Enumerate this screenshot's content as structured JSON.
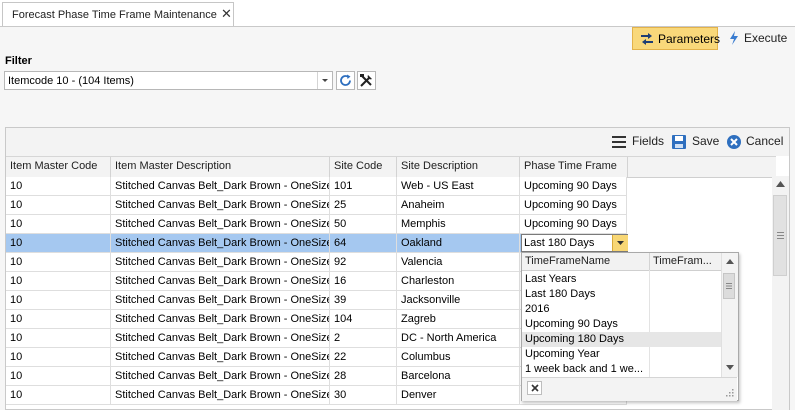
{
  "tab": {
    "title": "Forecast Phase Time Frame Maintenance",
    "close_glyph": "✕"
  },
  "toolbar": {
    "parameters_label": "Parameters",
    "execute_label": "Execute"
  },
  "filter": {
    "label": "Filter",
    "value": "Itemcode 10 - (104 Items)"
  },
  "grid_toolbar": {
    "fields_label": "Fields",
    "save_label": "Save",
    "cancel_label": "Cancel"
  },
  "columns": [
    "Item Master Code",
    "Item Master Description",
    "Site Code",
    "Site Description",
    "Phase Time Frame"
  ],
  "rows": [
    {
      "code": "10",
      "desc": "Stitched Canvas Belt_Dark Brown - OneSize",
      "site": "101",
      "site_desc": "Web - US East",
      "phase": "Upcoming 90 Days"
    },
    {
      "code": "10",
      "desc": "Stitched Canvas Belt_Dark Brown - OneSize",
      "site": "25",
      "site_desc": "Anaheim",
      "phase": "Upcoming 90 Days"
    },
    {
      "code": "10",
      "desc": "Stitched Canvas Belt_Dark Brown - OneSize",
      "site": "50",
      "site_desc": "Memphis",
      "phase": "Upcoming 90 Days"
    },
    {
      "code": "10",
      "desc": "Stitched Canvas Belt_Dark Brown - OneSize",
      "site": "64",
      "site_desc": "Oakland",
      "phase": "Last 180 Days"
    },
    {
      "code": "10",
      "desc": "Stitched Canvas Belt_Dark Brown - OneSize",
      "site": "92",
      "site_desc": "Valencia",
      "phase": ""
    },
    {
      "code": "10",
      "desc": "Stitched Canvas Belt_Dark Brown - OneSize",
      "site": "16",
      "site_desc": "Charleston",
      "phase": ""
    },
    {
      "code": "10",
      "desc": "Stitched Canvas Belt_Dark Brown - OneSize",
      "site": "39",
      "site_desc": "Jacksonville",
      "phase": ""
    },
    {
      "code": "10",
      "desc": "Stitched Canvas Belt_Dark Brown - OneSize",
      "site": "104",
      "site_desc": "Zagreb",
      "phase": ""
    },
    {
      "code": "10",
      "desc": "Stitched Canvas Belt_Dark Brown - OneSize",
      "site": "2",
      "site_desc": "DC - North America",
      "phase": ""
    },
    {
      "code": "10",
      "desc": "Stitched Canvas Belt_Dark Brown - OneSize",
      "site": "22",
      "site_desc": "Columbus",
      "phase": ""
    },
    {
      "code": "10",
      "desc": "Stitched Canvas Belt_Dark Brown - OneSize",
      "site": "28",
      "site_desc": "Barcelona",
      "phase": ""
    },
    {
      "code": "10",
      "desc": "Stitched Canvas Belt_Dark Brown - OneSize",
      "site": "30",
      "site_desc": "Denver",
      "phase": ""
    }
  ],
  "selected_row_index": 3,
  "editor": {
    "value": "Last 180 Days"
  },
  "dropdown": {
    "columns": [
      "TimeFrameName",
      "TimeFram..."
    ],
    "items": [
      "Last Years",
      "Last 180 Days",
      "2016",
      "Upcoming 90 Days",
      "Upcoming 180 Days",
      "Upcoming Year",
      "1 week back and 1 we..."
    ],
    "highlighted_index": 4
  },
  "colors": {
    "accent": "#f9d87a",
    "selection": "#a5c8f0",
    "icon_blue": "#2e6fbf"
  },
  "icons": [
    "close-icon",
    "parameters-icon",
    "execute-icon",
    "chevron-down-icon",
    "refresh-icon",
    "tools-icon",
    "fields-icon",
    "save-icon",
    "cancel-icon",
    "clear-icon"
  ]
}
